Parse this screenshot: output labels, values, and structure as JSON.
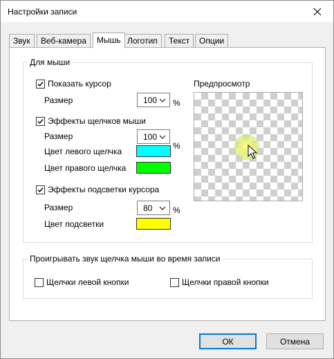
{
  "window": {
    "title": "Настройки записи"
  },
  "tabs": [
    {
      "label": "Звук",
      "active": false
    },
    {
      "label": "Веб-камера",
      "active": false
    },
    {
      "label": "Мышь",
      "active": true
    },
    {
      "label": "Логотип",
      "active": false
    },
    {
      "label": "Текст",
      "active": false
    },
    {
      "label": "Опции",
      "active": false
    }
  ],
  "mouse_group": {
    "legend": "Для мыши",
    "show_cursor": {
      "label": "Показать курсор",
      "checked": true,
      "size_label": "Размер",
      "size_value": "100",
      "unit": "%"
    },
    "click_effects": {
      "label": "Эффекты щелчков мыши",
      "checked": true,
      "size_label": "Размер",
      "size_value": "100",
      "unit": "%",
      "left_color_label": "Цвет левого щелчка",
      "left_color": "#00ffff",
      "right_color_label": "Цвет правого щелчка",
      "right_color": "#00ff00"
    },
    "highlight_effects": {
      "label": "Эффекты подсветки курсора",
      "checked": true,
      "size_label": "Размер",
      "size_value": "80",
      "unit": "%",
      "color_label": "Цвет подсветки",
      "color": "#ffff00"
    },
    "preview_label": "Предпросмотр"
  },
  "sound_group": {
    "legend": "Проигрывать звук щелчка мыши во время записи",
    "left_clicks": {
      "label": "Щелчки левой кнопки",
      "checked": false
    },
    "right_clicks": {
      "label": "Щелчки правой кнопки",
      "checked": false
    }
  },
  "buttons": {
    "ok": "ОК",
    "cancel": "Отмена"
  },
  "colors": {
    "accent": "#0078d7",
    "frame": "#f0f0f0"
  },
  "icons": {
    "close": "close-icon",
    "check": "checkmark-icon",
    "dropdown": "chevron-down-icon",
    "cursor": "mouse-pointer-icon"
  }
}
